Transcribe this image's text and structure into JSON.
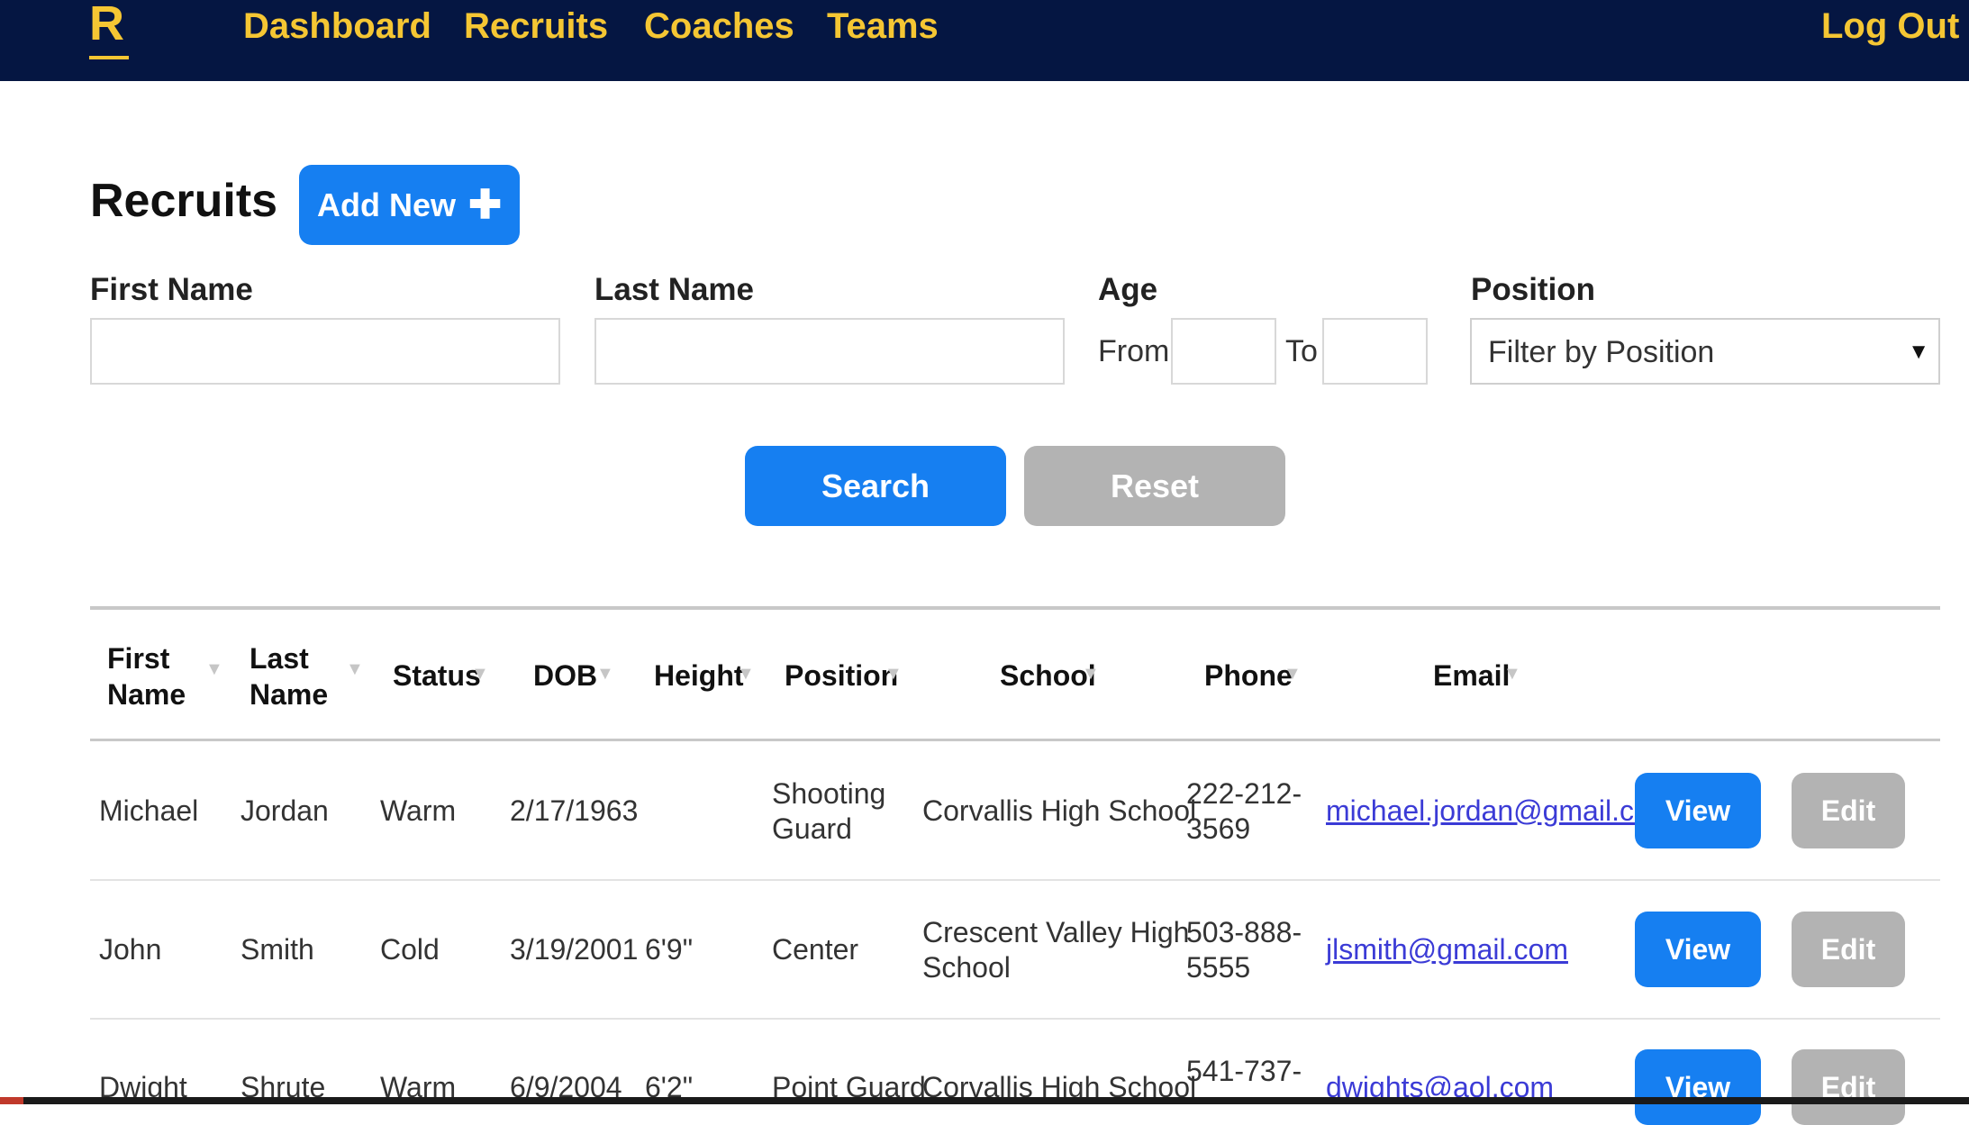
{
  "nav": {
    "logo": "R",
    "links": [
      "Dashboard",
      "Recruits",
      "Coaches",
      "Teams"
    ],
    "logout": "Log Out"
  },
  "page": {
    "title": "Recruits",
    "add_new_label": "Add New",
    "add_new_icon": "plus-icon"
  },
  "filters": {
    "first_name_label": "First Name",
    "last_name_label": "Last Name",
    "age_label": "Age",
    "age_from_label": "From",
    "age_to_label": "To",
    "position_label": "Position",
    "position_selected": "Filter by Position",
    "search_label": "Search",
    "reset_label": "Reset"
  },
  "table": {
    "headers": [
      "First Name",
      "Last Name",
      "Status",
      "DOB",
      "Height",
      "Position",
      "School",
      "Phone",
      "Email"
    ],
    "rows": [
      {
        "first": "Michael",
        "last": "Jordan",
        "status": "Warm",
        "dob": "2/17/1963",
        "height": "",
        "position": [
          "Shooting",
          "Guard"
        ],
        "school": [
          "Corvallis High School"
        ],
        "phone": [
          "222-212-",
          "3569"
        ],
        "email": "michael.jordan@gmail.com"
      },
      {
        "first": "John",
        "last": "Smith",
        "status": "Cold",
        "dob": "3/19/2001",
        "height": "6'9\"",
        "position": [
          "Center"
        ],
        "school": [
          "Crescent Valley High",
          "School"
        ],
        "phone": [
          "503-888-",
          "5555"
        ],
        "email": "jlsmith@gmail.com"
      },
      {
        "first": "Dwight",
        "last": "Shrute",
        "status": "Warm",
        "dob": "6/9/2004",
        "height": "6'2\"",
        "position": [
          "Point Guard"
        ],
        "school": [
          "Corvallis High School"
        ],
        "phone": [
          "541-737-"
        ],
        "email": "dwights@aol.com"
      }
    ],
    "view_label": "View",
    "edit_label": "Edit"
  },
  "colors": {
    "nav_bg": "#051642",
    "nav_text": "#f5c633",
    "primary": "#167ff1",
    "secondary": "#b3b3b3"
  }
}
